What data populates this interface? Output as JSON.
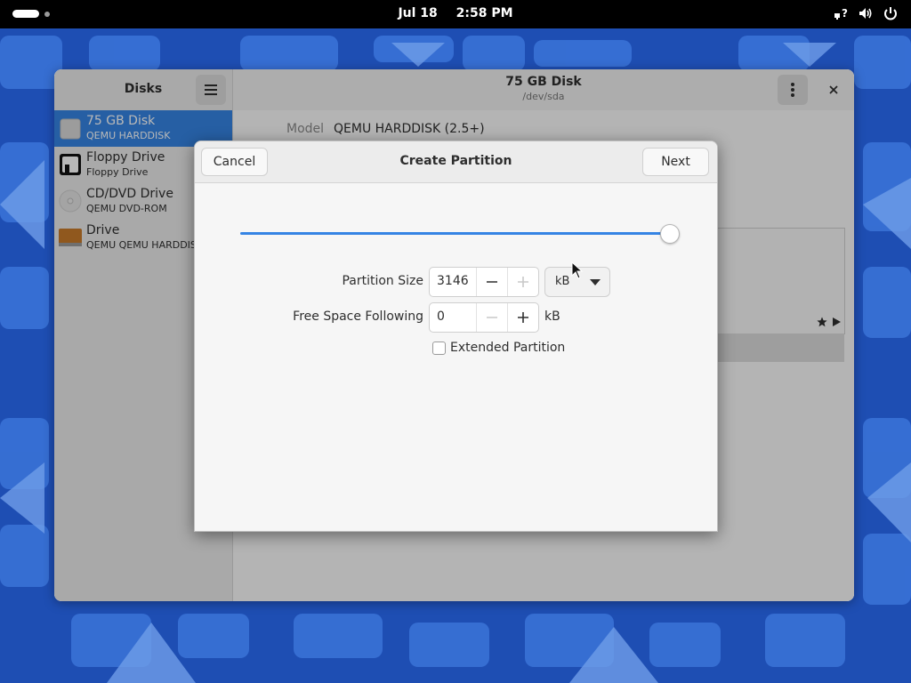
{
  "topbar": {
    "date": "Jul 18",
    "time": "2:58 PM"
  },
  "window": {
    "sidebar_title": "Disks",
    "disk_title": "75 GB Disk",
    "disk_subtitle": "/dev/sda",
    "model_label": "Model",
    "model_value": "QEMU HARDDISK (2.5+)"
  },
  "drives": [
    {
      "name": "75 GB Disk",
      "sub": "QEMU HARDDISK",
      "selected": true
    },
    {
      "name": "Floppy Drive",
      "sub": "Floppy Drive"
    },
    {
      "name": "CD/DVD Drive",
      "sub": "QEMU DVD-ROM"
    },
    {
      "name": "Drive",
      "sub": "QEMU QEMU HARDDISK"
    }
  ],
  "dialog": {
    "title": "Create Partition",
    "cancel": "Cancel",
    "next": "Next",
    "slider_fraction": 1.0,
    "size_label": "Partition Size",
    "size_value": "3146",
    "size_unit": "kB",
    "free_label": "Free Space Following",
    "free_value": "0",
    "free_unit": "kB",
    "extended_label": "Extended Partition",
    "extended_checked": false
  },
  "colors": {
    "accent": "#3584e4",
    "wallpaper": "#1f4fb5"
  }
}
